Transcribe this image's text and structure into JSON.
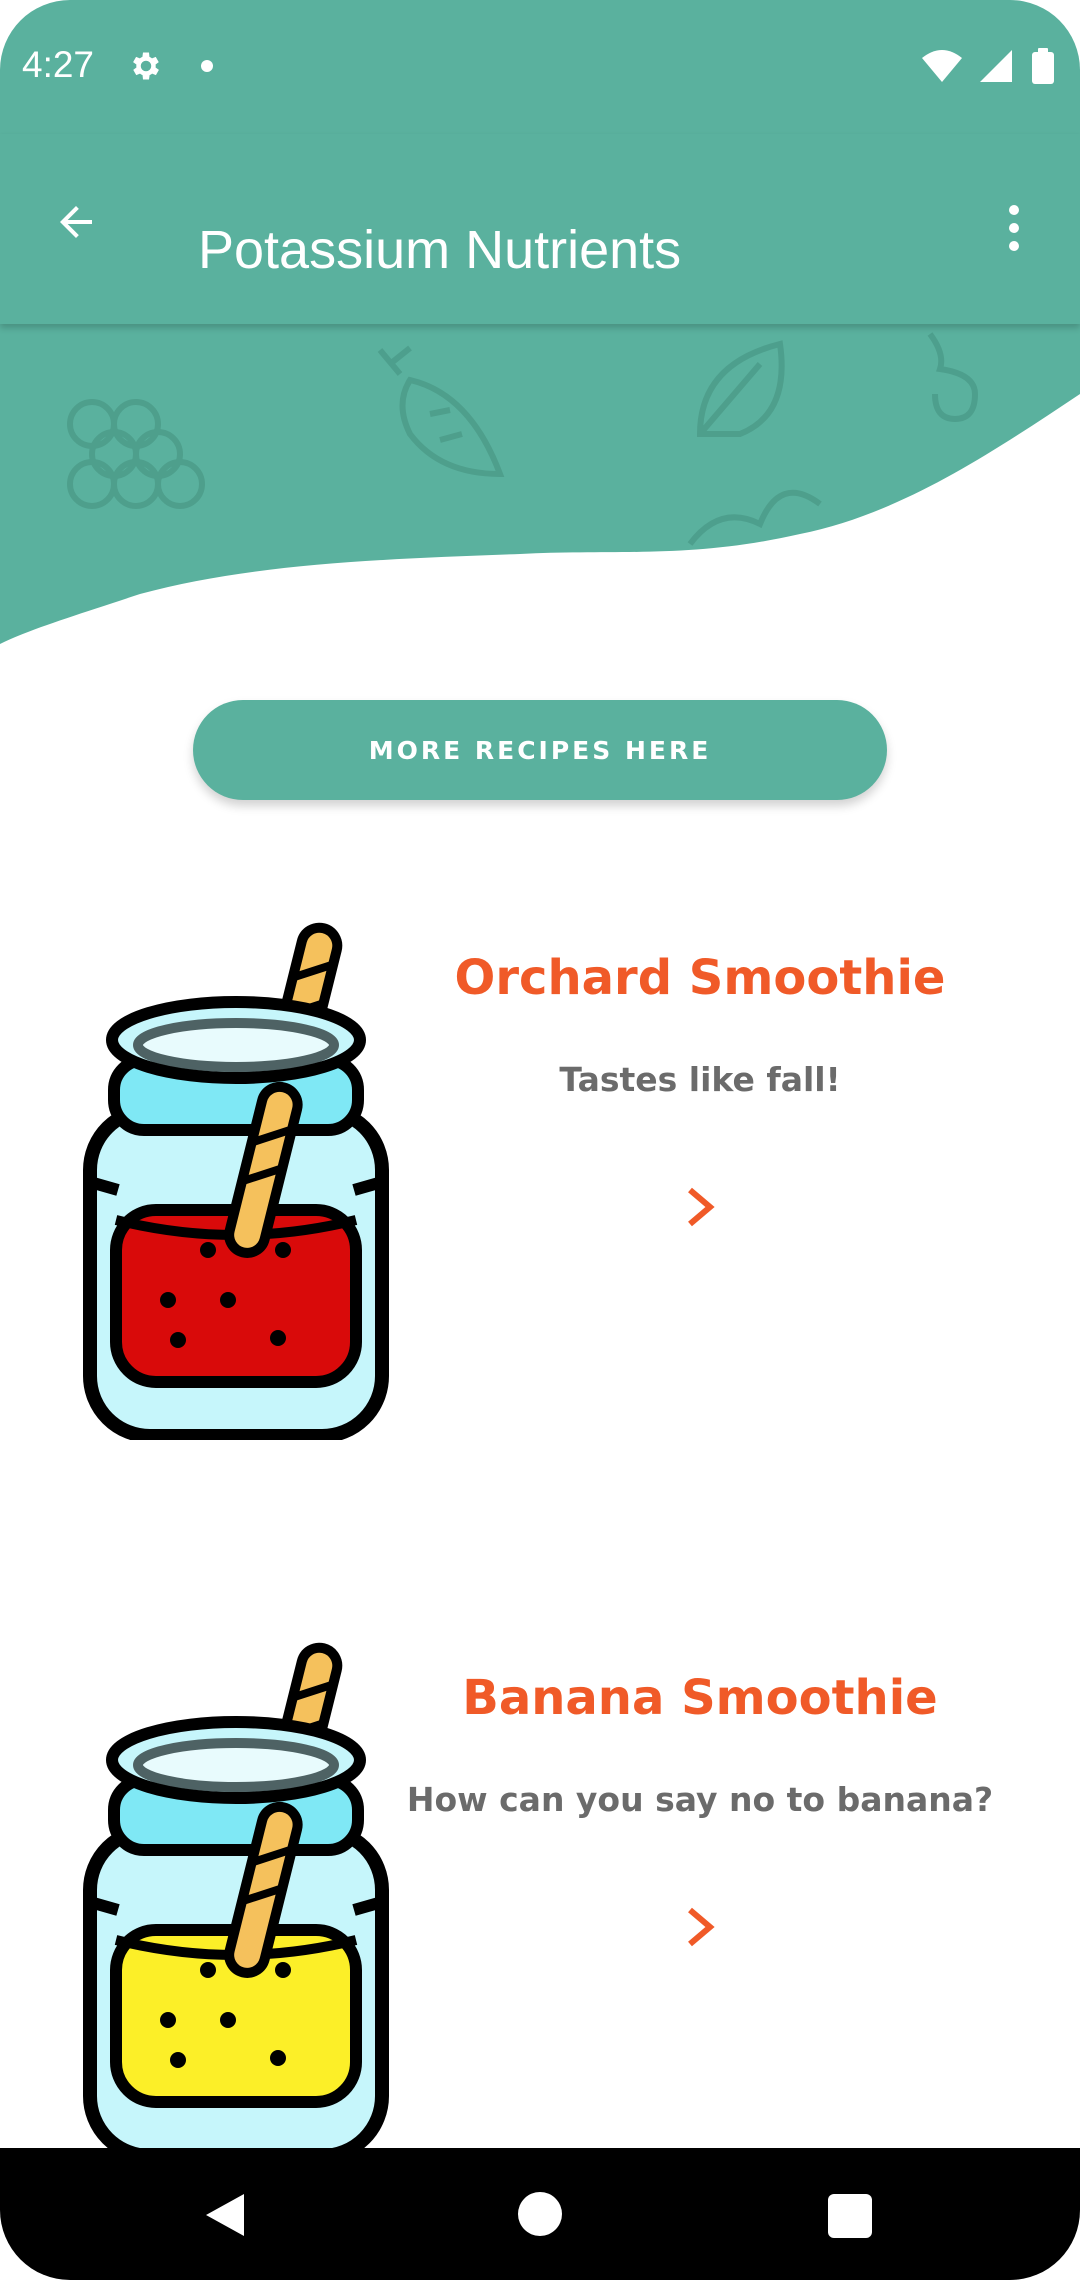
{
  "status_bar": {
    "time": "4:27"
  },
  "app_bar": {
    "title": "Potassium Nutrients"
  },
  "cta": {
    "label": "MORE RECIPES HERE"
  },
  "recipes": [
    {
      "title": "Orchard Smoothie",
      "subtitle": "Tastes like fall!",
      "liquid_color": "#d90a0a"
    },
    {
      "title": "Banana Smoothie",
      "subtitle": "How can you say no to banana?",
      "liquid_color": "#fcef28"
    }
  ],
  "colors": {
    "primary": "#5ab19e",
    "accent": "#f05a28",
    "subtitle": "#6b6b6b"
  },
  "icons": {
    "status": [
      "gear-icon",
      "dot-icon",
      "wifi-icon",
      "signal-icon",
      "battery-icon"
    ],
    "app_bar": [
      "back-arrow-icon",
      "more-vert-icon"
    ],
    "recipe": [
      "jar-icon",
      "chevron-right-icon"
    ],
    "nav": [
      "nav-back-icon",
      "nav-home-icon",
      "nav-recents-icon"
    ]
  }
}
